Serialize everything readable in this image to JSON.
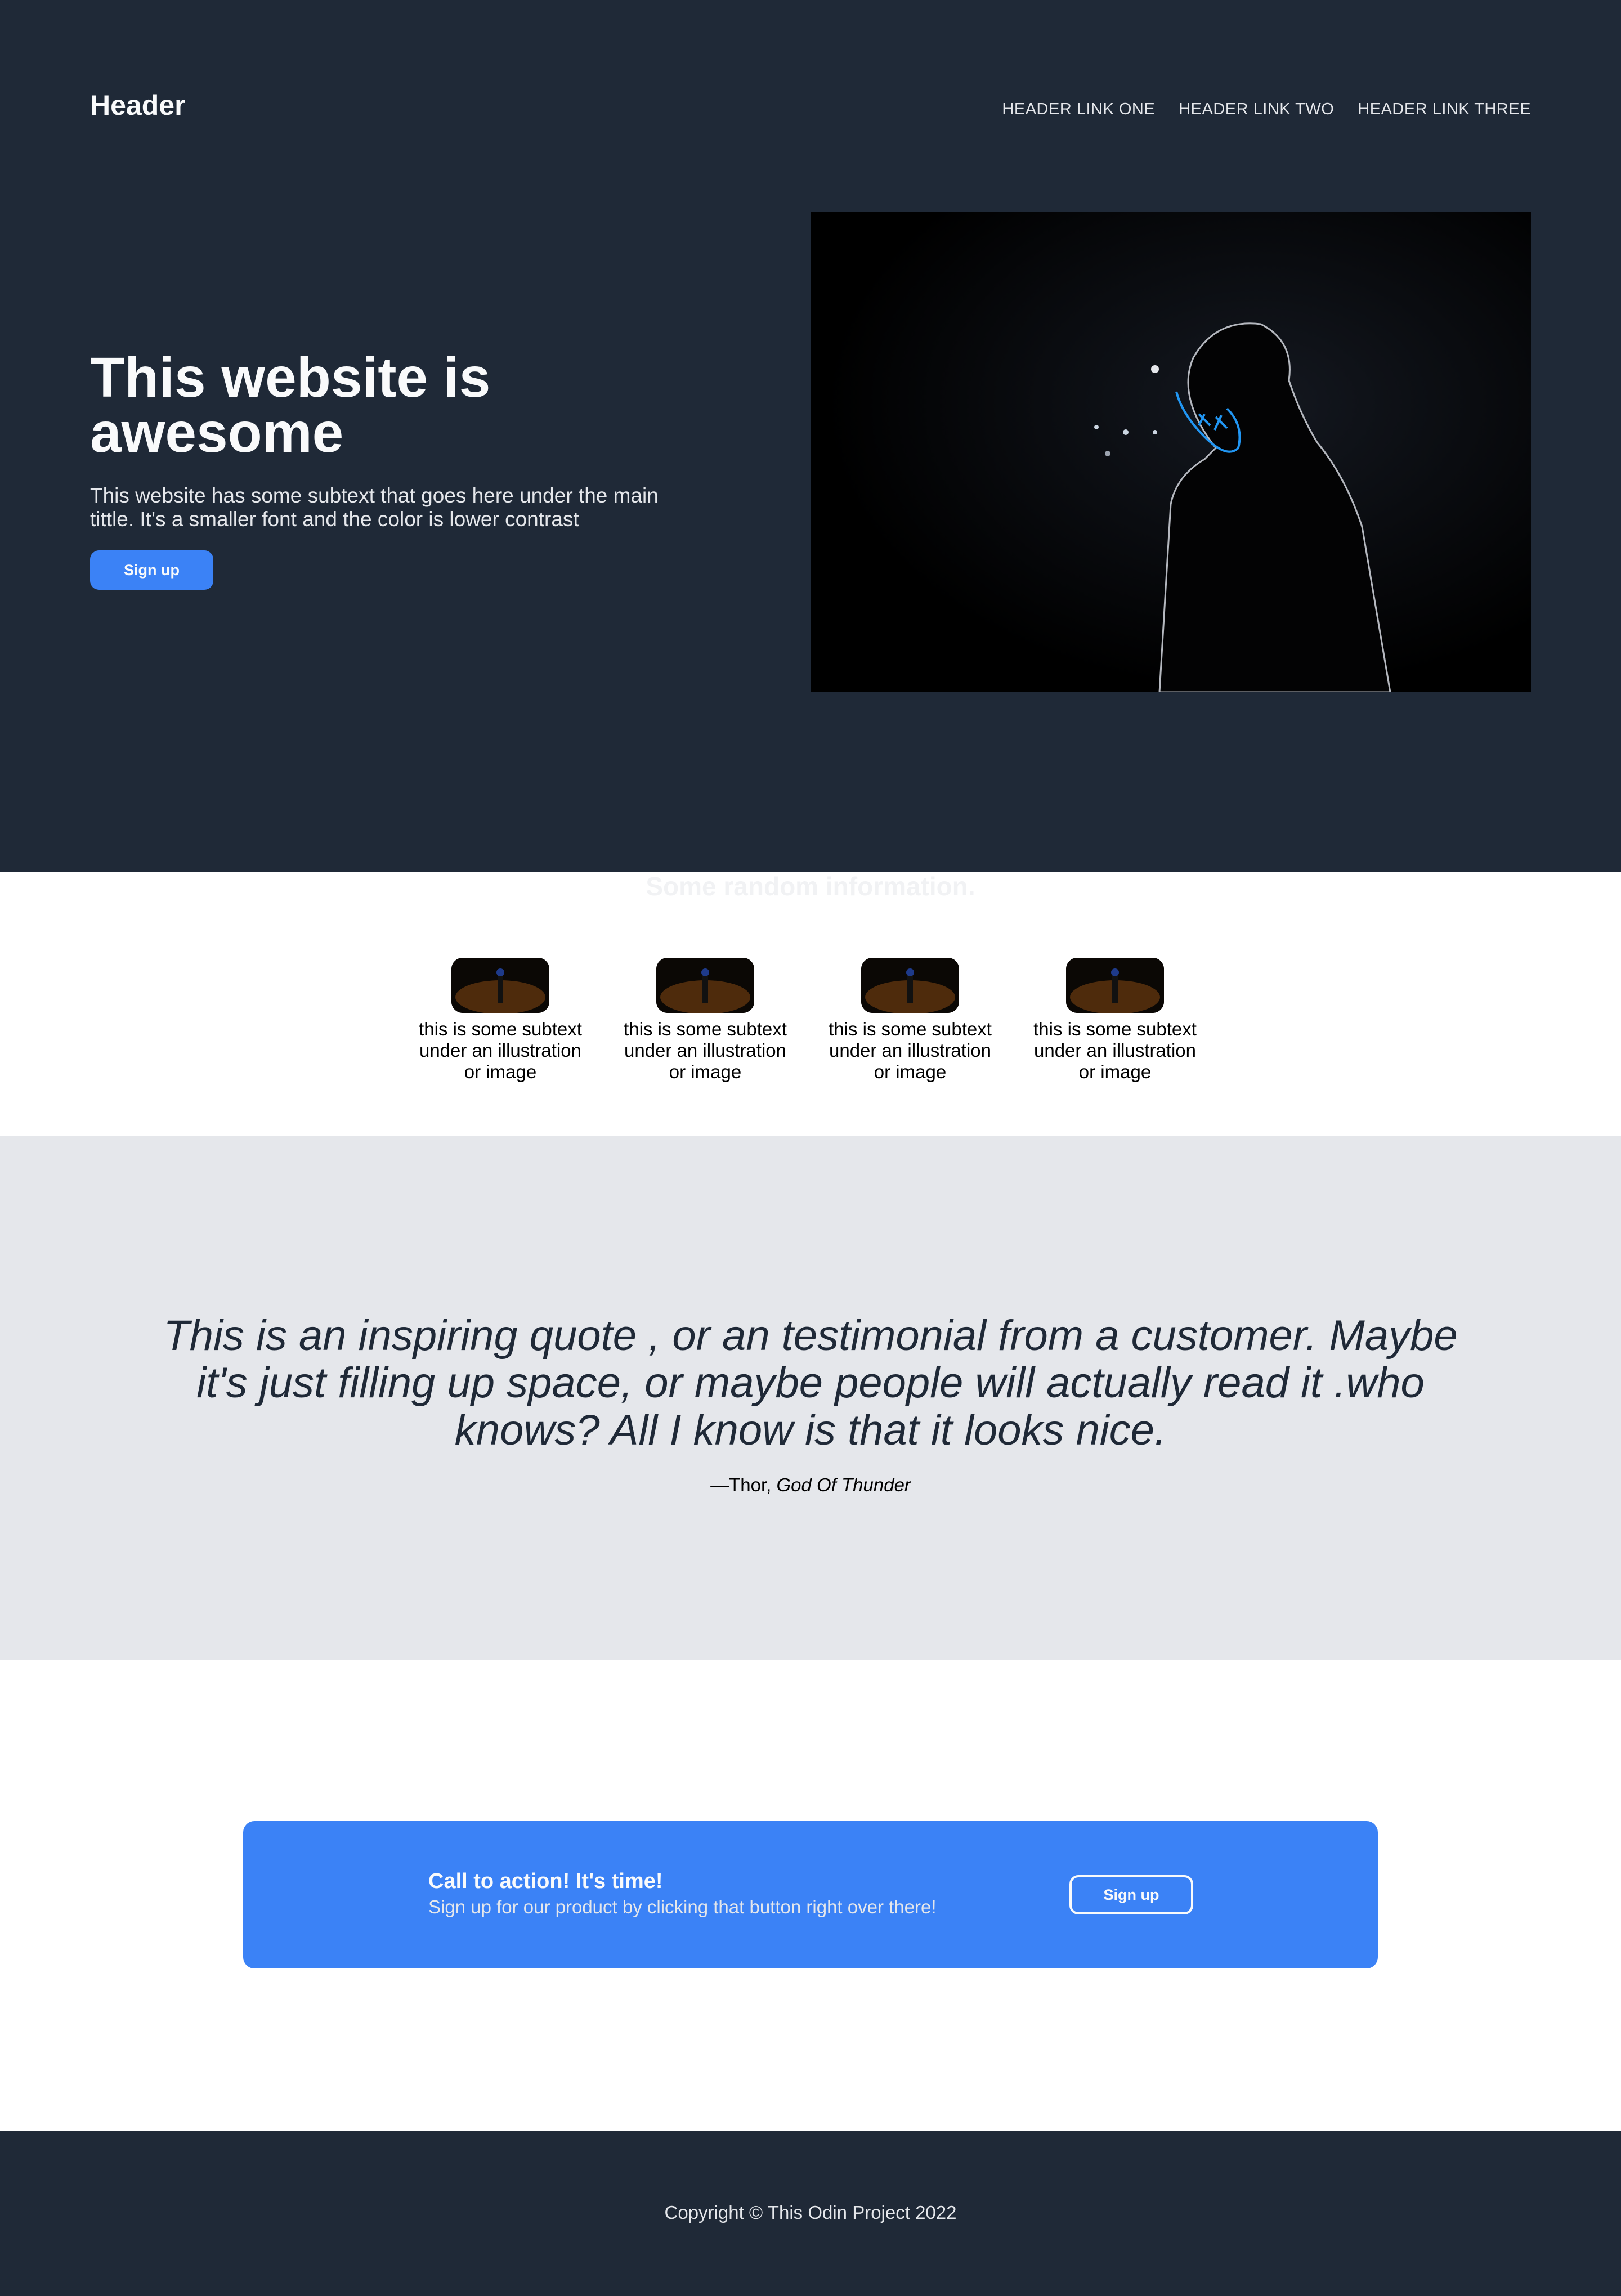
{
  "header": {
    "logo": "Header",
    "links": [
      "HEADER LINK ONE",
      "HEADER LINK TWO",
      "HEADER LINK THREE"
    ]
  },
  "hero": {
    "title": "This website is awesome",
    "subtext": "This website has some subtext that goes here under the main tittle. It's a smaller font and the color is lower contrast",
    "button_label": "Sign up"
  },
  "info": {
    "title": "Some random information.",
    "cards": [
      {
        "text": "this is some subtext under an illustration or image"
      },
      {
        "text": "this is some subtext under an illustration or image"
      },
      {
        "text": "this is some subtext under an illustration or image"
      },
      {
        "text": "this is some subtext under an illustration or image"
      }
    ]
  },
  "quote": {
    "text": "This is an inspiring quote , or an testimonial from a customer. Maybe it's just filling up space, or maybe people will actually read it .who knows? All I know is that it looks nice.",
    "author": "—Thor, ",
    "author_title": "God Of Thunder"
  },
  "cta": {
    "title": "Call to action! It's time!",
    "subtext": "Sign up for our product by clicking that button right over there!",
    "button_label": "Sign up"
  },
  "footer": {
    "copyright": "Copyright © This Odin Project 2022"
  },
  "colors": {
    "dark_bg": "#1f2937",
    "accent": "#3b82f6",
    "quote_bg": "#e5e7eb",
    "light_text": "#f9fafb"
  }
}
